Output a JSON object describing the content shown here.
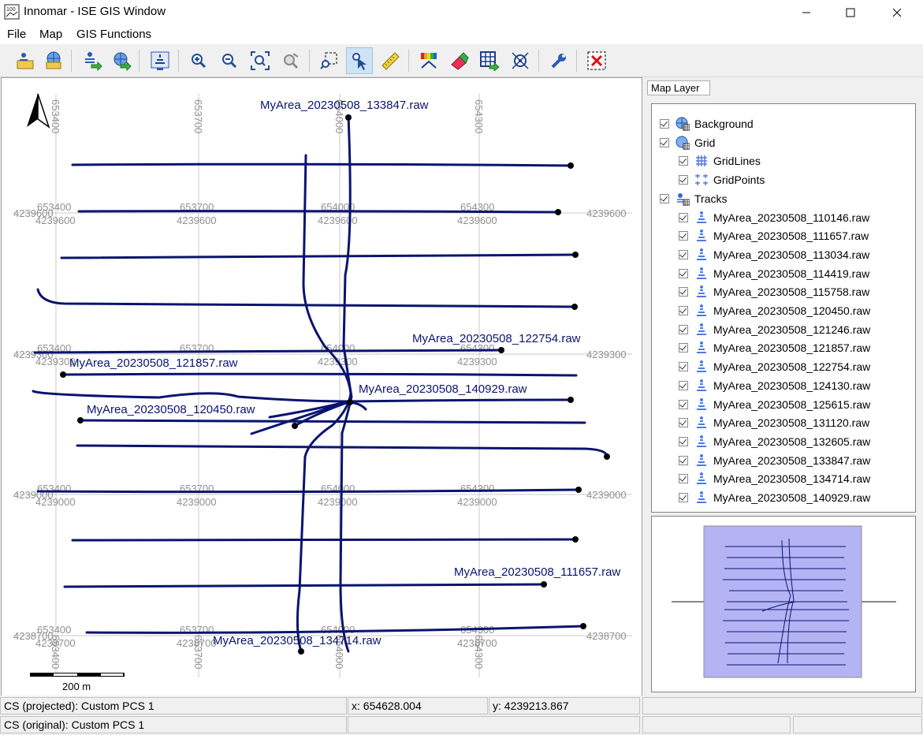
{
  "window": {
    "title": "Innomar - ISE GIS Window",
    "minimize": "—",
    "maximize": "☐",
    "close": "✕"
  },
  "menu": [
    "File",
    "Map",
    "GIS Functions"
  ],
  "toolbar_icons": [
    "open-track-icon",
    "open-map-icon",
    "export-track-icon",
    "export-map-icon",
    "echosounder-icon",
    "zoom-in-icon",
    "zoom-out-icon",
    "zoom-fit-icon",
    "pan-icon",
    "select-region-icon",
    "select-pointer-icon",
    "measure-ruler-icon",
    "color-scale-icon",
    "eraser-icon",
    "grid-export-icon",
    "target-icon",
    "settings-wrench-icon",
    "clear-red-x-icon"
  ],
  "map": {
    "north_arrow": "north-arrow-icon",
    "scale_label": "200 m",
    "easting_labels": [
      "653400",
      "653700",
      "654000",
      "654300"
    ],
    "northing_labels": [
      "4239600",
      "4239300",
      "4239000",
      "4238700"
    ],
    "track_labels": [
      "MyArea_20230508_133847.raw",
      "MyArea_20230508_122754.raw",
      "MyArea_20230508_121857.raw",
      "MyArea_20230508_140929.raw",
      "MyArea_20230508_120450.raw",
      "MyArea_20230508_111657.raw",
      "MyArea_20230508_134714.raw"
    ],
    "track_color": "#0a1470",
    "grid_color": "#c0c0c0"
  },
  "layers": {
    "tab": "Map Layer",
    "items": [
      {
        "label": "Background",
        "level": 0,
        "icon": "globe-icon"
      },
      {
        "label": "Grid",
        "level": 0,
        "icon": "grid-layer-icon"
      },
      {
        "label": "GridLines",
        "level": 1,
        "icon": "gridlines-icon"
      },
      {
        "label": "GridPoints",
        "level": 1,
        "icon": "gridpoints-icon"
      },
      {
        "label": "Tracks",
        "level": 0,
        "icon": "tracks-layer-icon"
      },
      {
        "label": "MyArea_20230508_110146.raw",
        "level": 1,
        "icon": "track-file-icon"
      },
      {
        "label": "MyArea_20230508_111657.raw",
        "level": 1,
        "icon": "track-file-icon"
      },
      {
        "label": "MyArea_20230508_113034.raw",
        "level": 1,
        "icon": "track-file-icon"
      },
      {
        "label": "MyArea_20230508_114419.raw",
        "level": 1,
        "icon": "track-file-icon"
      },
      {
        "label": "MyArea_20230508_115758.raw",
        "level": 1,
        "icon": "track-file-icon"
      },
      {
        "label": "MyArea_20230508_120450.raw",
        "level": 1,
        "icon": "track-file-icon"
      },
      {
        "label": "MyArea_20230508_121246.raw",
        "level": 1,
        "icon": "track-file-icon"
      },
      {
        "label": "MyArea_20230508_121857.raw",
        "level": 1,
        "icon": "track-file-icon"
      },
      {
        "label": "MyArea_20230508_122754.raw",
        "level": 1,
        "icon": "track-file-icon"
      },
      {
        "label": "MyArea_20230508_124130.raw",
        "level": 1,
        "icon": "track-file-icon"
      },
      {
        "label": "MyArea_20230508_125615.raw",
        "level": 1,
        "icon": "track-file-icon"
      },
      {
        "label": "MyArea_20230508_131120.raw",
        "level": 1,
        "icon": "track-file-icon"
      },
      {
        "label": "MyArea_20230508_132605.raw",
        "level": 1,
        "icon": "track-file-icon"
      },
      {
        "label": "MyArea_20230508_133847.raw",
        "level": 1,
        "icon": "track-file-icon"
      },
      {
        "label": "MyArea_20230508_134714.raw",
        "level": 1,
        "icon": "track-file-icon"
      },
      {
        "label": "MyArea_20230508_140929.raw",
        "level": 1,
        "icon": "track-file-icon"
      }
    ]
  },
  "status": {
    "cs_projected": "CS (projected): Custom PCS 1",
    "cs_original": "CS (original): Custom PCS 1",
    "x": "x: 654628.004",
    "y": "y: 4239213.867"
  },
  "overview": {
    "fill": "#b4b4f4"
  }
}
